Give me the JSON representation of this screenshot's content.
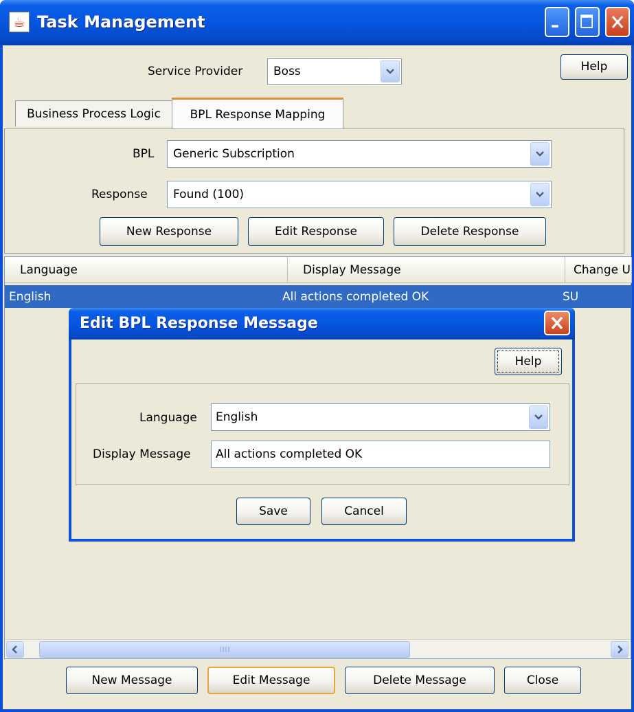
{
  "window": {
    "title": "Task Management",
    "help_label": "Help"
  },
  "service_provider": {
    "label": "Service Provider",
    "value": "Boss"
  },
  "tabs": [
    {
      "label": "Business Process Logic",
      "active": false
    },
    {
      "label": "BPL Response Mapping",
      "active": true
    }
  ],
  "bpl": {
    "label": "BPL",
    "value": "Generic Subscription"
  },
  "response": {
    "label": "Response",
    "value": "Found (100)"
  },
  "response_buttons": {
    "new": "New Response",
    "edit": "Edit Response",
    "delete": "Delete Response"
  },
  "table": {
    "columns": [
      "Language",
      "Display Message",
      "Change U"
    ],
    "rows": [
      {
        "language": "English",
        "message": "All actions completed OK",
        "change_user": "SU"
      }
    ]
  },
  "bottom_buttons": {
    "new": "New Message",
    "edit": "Edit Message",
    "delete": "Delete Message",
    "close": "Close"
  },
  "dialog": {
    "title": "Edit BPL Response Message",
    "help_label": "Help",
    "language_label": "Language",
    "language_value": "English",
    "message_label": "Display Message",
    "message_value": "All actions completed OK",
    "save_label": "Save",
    "cancel_label": "Cancel"
  },
  "colors": {
    "titlebar": "#0756e0",
    "selection": "#316ac5",
    "window_bg": "#ece9d8"
  }
}
